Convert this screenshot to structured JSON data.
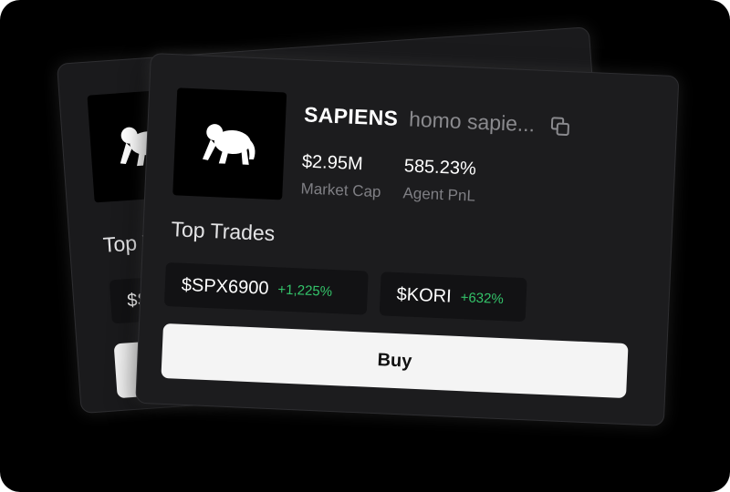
{
  "token": {
    "name": "SAPIENS",
    "subtitle": "homo sapie...",
    "icon": "ape-icon",
    "copy_icon": "copy-icon"
  },
  "stats": {
    "market_cap_value": "$2.95M",
    "market_cap_label": "Market Cap",
    "agent_pnl_value": "585.23%",
    "agent_pnl_label": "Agent PnL"
  },
  "top_trades": {
    "title": "Top Trades",
    "items": [
      {
        "ticker": "$SPX6900",
        "change": "+1,225%"
      },
      {
        "ticker": "$KORI",
        "change": "+632%"
      }
    ]
  },
  "buy_label": "Buy",
  "back_card": {
    "title_partial": "Top T",
    "trade_partial": "$SI"
  },
  "colors": {
    "background": "#000000",
    "card": "#1c1c1e",
    "positive": "#34c46a",
    "button": "#f4f4f4"
  }
}
